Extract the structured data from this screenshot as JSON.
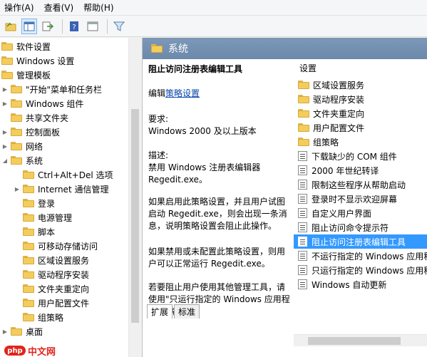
{
  "menu": [
    "操作(A)",
    "查看(V)",
    "帮助(H)"
  ],
  "toolbar": {
    "icons": [
      "folder-icon",
      "pane-icon",
      "export-icon",
      "help-icon",
      "view-icon",
      "filter-icon"
    ]
  },
  "tree": {
    "items": [
      {
        "label": "软件设置",
        "expander": ""
      },
      {
        "label": "Windows 设置",
        "expander": ""
      },
      {
        "label": "管理模板",
        "expander": ""
      },
      {
        "label": "\"开始\"菜单和任务栏",
        "expander": "▶"
      },
      {
        "label": "Windows 组件",
        "expander": "▶"
      },
      {
        "label": "共享文件夹",
        "expander": ""
      },
      {
        "label": "控制面板",
        "expander": "▶"
      },
      {
        "label": "网络",
        "expander": "▶"
      },
      {
        "label": "系统",
        "expander": "◢"
      },
      {
        "label": "Ctrl+Alt+Del 选项",
        "expander": ""
      },
      {
        "label": "Internet 通信管理",
        "expander": "▶"
      },
      {
        "label": "登录",
        "expander": ""
      },
      {
        "label": "电源管理",
        "expander": ""
      },
      {
        "label": "脚本",
        "expander": ""
      },
      {
        "label": "可移动存储访问",
        "expander": ""
      },
      {
        "label": "区域设置服务",
        "expander": ""
      },
      {
        "label": "驱动程序安装",
        "expander": ""
      },
      {
        "label": "文件夹重定向",
        "expander": ""
      },
      {
        "label": "用户配置文件",
        "expander": ""
      },
      {
        "label": "组策略",
        "expander": ""
      },
      {
        "label": "桌面",
        "expander": "▶"
      }
    ]
  },
  "header": {
    "title": "系统"
  },
  "description": {
    "title": "阻止访问注册表编辑工具",
    "edit_prefix": "编辑",
    "edit_link": "策略设置",
    "req_label": "要求:",
    "req_value": "Windows 2000 及以上版本",
    "desc_label": "描述:",
    "desc_value": "禁用 Windows 注册表编辑器 Regedit.exe。",
    "enabled_text": "如果启用此策略设置，并且用户试图启动 Regedit.exe，则会出现一条消息，说明策略设置会阻止此操作。",
    "disabled_text": "如果禁用或未配置此策略设置，则用户可以正常运行 Regedit.exe。",
    "extra_text": "若要阻止用户使用其他管理工具，请使用\"只运行指定的 Windows 应用程序\"策略设置。"
  },
  "list": {
    "header": "设置",
    "items": [
      {
        "label": "区域设置服务",
        "type": "folder"
      },
      {
        "label": "驱动程序安装",
        "type": "folder"
      },
      {
        "label": "文件夹重定向",
        "type": "folder"
      },
      {
        "label": "用户配置文件",
        "type": "folder"
      },
      {
        "label": "组策略",
        "type": "folder"
      },
      {
        "label": "下载缺少的 COM 组件",
        "type": "setting"
      },
      {
        "label": "2000 年世纪转译",
        "type": "setting"
      },
      {
        "label": "限制这些程序从帮助启动",
        "type": "setting"
      },
      {
        "label": "登录时不显示欢迎屏幕",
        "type": "setting"
      },
      {
        "label": "自定义用户界面",
        "type": "setting"
      },
      {
        "label": "阻止访问命令提示符",
        "type": "setting"
      },
      {
        "label": "阻止访问注册表编辑工具",
        "type": "setting",
        "selected": true
      },
      {
        "label": "不运行指定的 Windows 应用程序",
        "type": "setting"
      },
      {
        "label": "只运行指定的 Windows 应用程序",
        "type": "setting"
      },
      {
        "label": "Windows 自动更新",
        "type": "setting"
      }
    ]
  },
  "tabs": [
    "扩展",
    "标准"
  ],
  "watermark": {
    "badge": "php",
    "text": "中文网"
  }
}
